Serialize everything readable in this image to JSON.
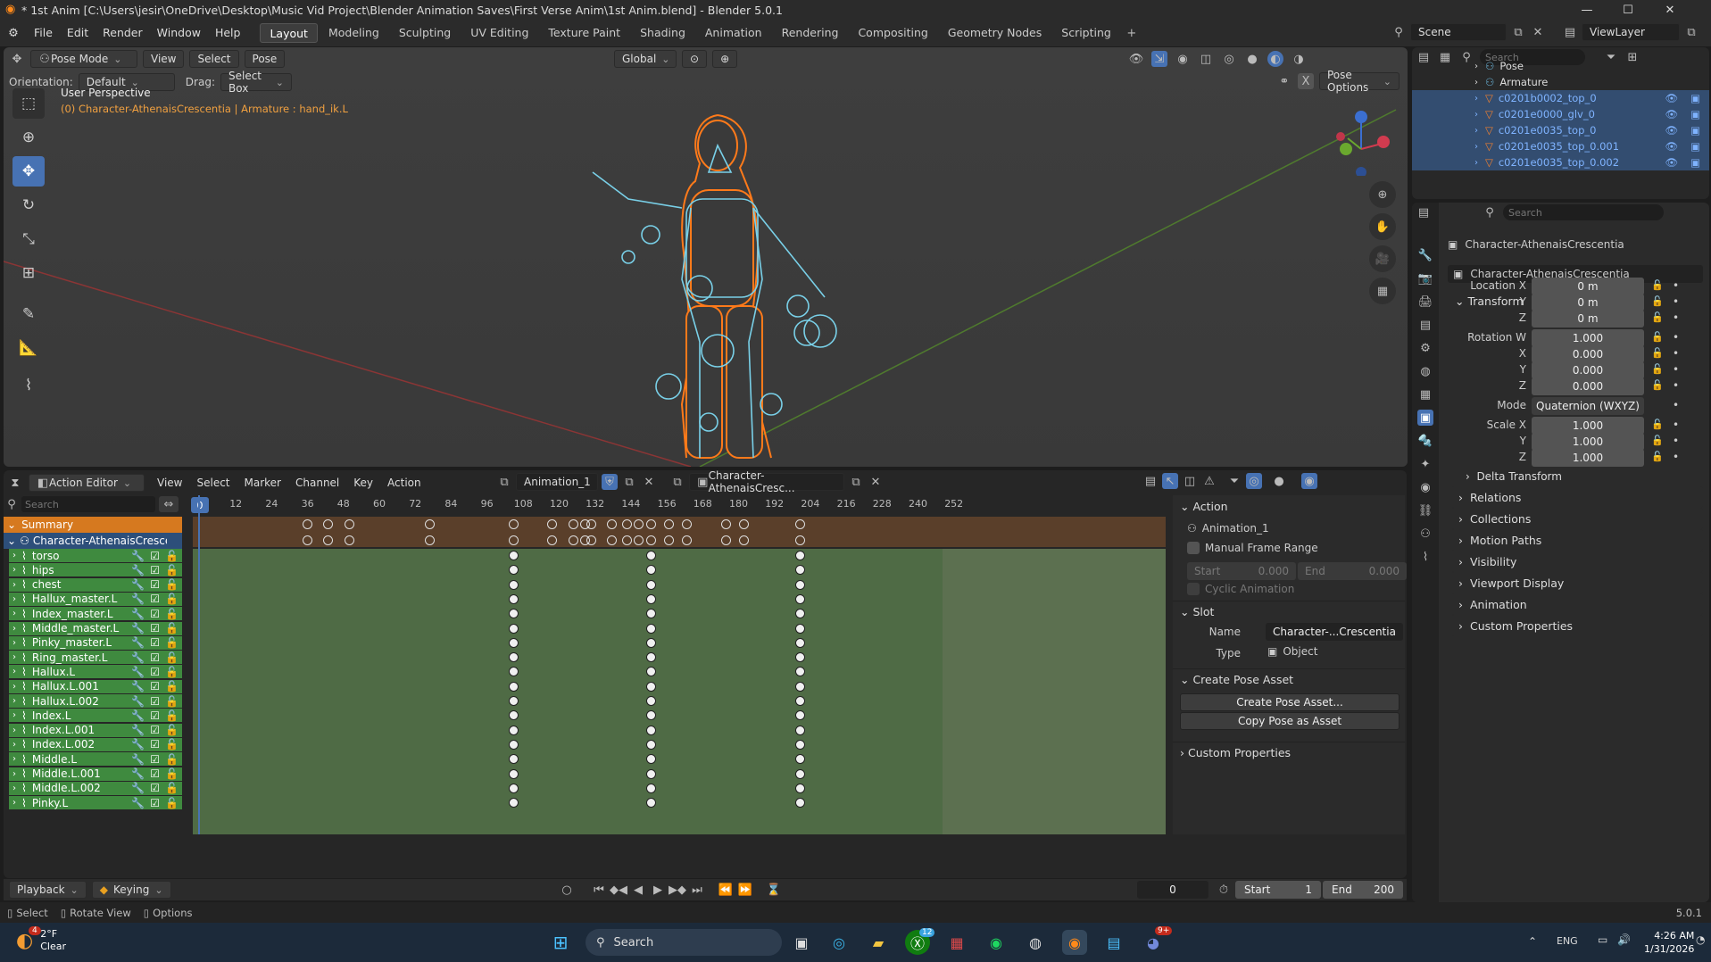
{
  "window": {
    "title": "* 1st Anim [C:\\Users\\jesir\\OneDrive\\Desktop\\Music Vid Project\\Blender Animation Saves\\First Verse Anim\\1st Anim.blend] - Blender 5.0.1"
  },
  "menu": [
    "File",
    "Edit",
    "Render",
    "Window",
    "Help"
  ],
  "workspaces": [
    "Layout",
    "Modeling",
    "Sculpting",
    "UV Editing",
    "Texture Paint",
    "Shading",
    "Animation",
    "Rendering",
    "Compositing",
    "Geometry Nodes",
    "Scripting"
  ],
  "scene": "Scene",
  "viewlayer": "ViewLayer",
  "viewport": {
    "mode": "Pose Mode",
    "menus": [
      "View",
      "Select",
      "Pose"
    ],
    "orientation_label": "Orientation:",
    "orientation_value": "Default",
    "drag_label": "Drag:",
    "drag_value": "Select Box",
    "transform_orientation": "Global",
    "pose_options": "Pose Options",
    "overlay_title": "User Perspective",
    "overlay_sub": "(0) Character-AthenaisCrescentia | Armature : hand_ik.L"
  },
  "action_editor": {
    "editor_type": "Action Editor",
    "menus": [
      "View",
      "Select",
      "Marker",
      "Channel",
      "Key",
      "Action"
    ],
    "action_name": "Animation_1",
    "object_name": "Character-AthenaisCresc...",
    "search_placeholder": "Search",
    "ticks": [
      "0",
      "12",
      "24",
      "36",
      "48",
      "60",
      "72",
      "84",
      "96",
      "108",
      "120",
      "132",
      "144",
      "156",
      "168",
      "180",
      "192",
      "204",
      "216",
      "228",
      "240",
      "252"
    ],
    "current_frame": "0",
    "summary": "Summary",
    "object_row": "Character-AthenaisCrescentia",
    "channels": [
      "torso",
      "hips",
      "chest",
      "Hallux_master.L",
      "Index_master.L",
      "Middle_master.L",
      "Pinky_master.L",
      "Ring_master.L",
      "Hallux.L",
      "Hallux.L.001",
      "Hallux.L.002",
      "Index.L",
      "Index.L.001",
      "Index.L.002",
      "Middle.L",
      "Middle.L.001",
      "Middle.L.002",
      "Pinky.L"
    ],
    "summary_keys": [
      36,
      43,
      50,
      77,
      105,
      118,
      125,
      129,
      131,
      138,
      143,
      147,
      151,
      157,
      163,
      176,
      182,
      201
    ],
    "bone_keys": [
      105,
      151,
      201
    ],
    "sidebar": {
      "action_header": "Action",
      "action_name": "Animation_1",
      "manual_frame_range": "Manual Frame Range",
      "start_label": "Start",
      "start_value": "0.000",
      "end_label": "End",
      "end_value": "0.000",
      "cyclic": "Cyclic Animation",
      "slot_header": "Slot",
      "name_label": "Name",
      "name_value": "Character-...Crescentia",
      "type_label": "Type",
      "type_value": "Object",
      "create_pose_header": "Create Pose Asset",
      "create_pose_btn": "Create Pose Asset...",
      "copy_pose_btn": "Copy Pose as Asset",
      "custom_props": "Custom Properties"
    }
  },
  "timeline": {
    "playback": "Playback",
    "keying": "Keying",
    "frame": "0",
    "start_label": "Start",
    "start_value": "1",
    "end_label": "End",
    "end_value": "200"
  },
  "outliner": {
    "search_placeholder": "Search",
    "items": [
      "Pose",
      "Armature",
      "c0201b0002_top_0",
      "c0201e0000_glv_0",
      "c0201e0035_top_0",
      "c0201e0035_top_0.001",
      "c0201e0035_top_0.002"
    ]
  },
  "properties": {
    "search_placeholder": "Search",
    "object_name": "Character-AthenaisCrescentia",
    "data_name": "Character-AthenaisCrescentia",
    "transform_header": "Transform",
    "location_label": "Location X",
    "y_label": "Y",
    "z_label": "Z",
    "x_label": "X",
    "rotation_label": "Rotation W",
    "mode_label": "Mode",
    "scale_label": "Scale X",
    "location": [
      "0 m",
      "0 m",
      "0 m"
    ],
    "rotation": [
      "1.000",
      "0.000",
      "0.000",
      "0.000"
    ],
    "mode": "Quaternion (WXYZ)",
    "scale": [
      "1.000",
      "1.000",
      "1.000"
    ],
    "delta": "Delta Transform",
    "sections": [
      "Relations",
      "Collections",
      "Motion Paths",
      "Visibility",
      "Viewport Display",
      "Animation",
      "Custom Properties"
    ]
  },
  "statusbar": {
    "select": "Select",
    "rotate": "Rotate View",
    "options": "Options",
    "version": "5.0.1"
  },
  "taskbar": {
    "weather_temp": "2°F",
    "weather_desc": "Clear",
    "weather_badge": "4",
    "search": "Search",
    "lang": "ENG",
    "time": "4:26 AM",
    "date": "1/31/2026",
    "xbox_badge": "12",
    "discord_badge": "9+"
  },
  "colors": {
    "accent": "#4772b3",
    "bone_channel": "#3f8a3f",
    "summary": "#d6791f",
    "selection": "#ff8a1a",
    "bones": "#79d0e8"
  }
}
